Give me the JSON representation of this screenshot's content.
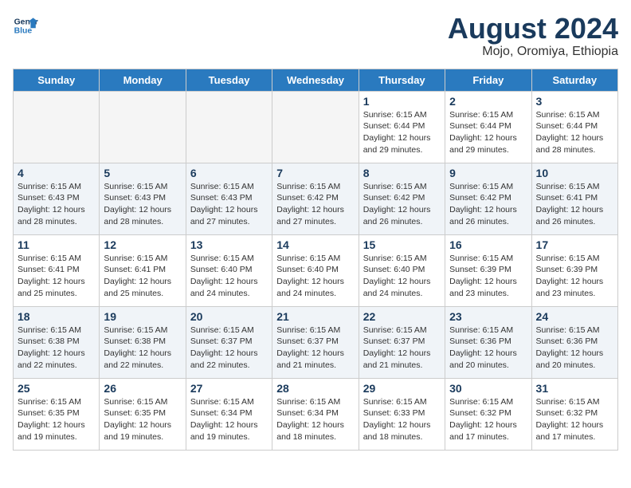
{
  "header": {
    "logo_line1": "General",
    "logo_line2": "Blue",
    "month_year": "August 2024",
    "location": "Mojo, Oromiya, Ethiopia"
  },
  "weekdays": [
    "Sunday",
    "Monday",
    "Tuesday",
    "Wednesday",
    "Thursday",
    "Friday",
    "Saturday"
  ],
  "weeks": [
    [
      {
        "day": "",
        "info": ""
      },
      {
        "day": "",
        "info": ""
      },
      {
        "day": "",
        "info": ""
      },
      {
        "day": "",
        "info": ""
      },
      {
        "day": "1",
        "info": "Sunrise: 6:15 AM\nSunset: 6:44 PM\nDaylight: 12 hours\nand 29 minutes."
      },
      {
        "day": "2",
        "info": "Sunrise: 6:15 AM\nSunset: 6:44 PM\nDaylight: 12 hours\nand 29 minutes."
      },
      {
        "day": "3",
        "info": "Sunrise: 6:15 AM\nSunset: 6:44 PM\nDaylight: 12 hours\nand 28 minutes."
      }
    ],
    [
      {
        "day": "4",
        "info": "Sunrise: 6:15 AM\nSunset: 6:43 PM\nDaylight: 12 hours\nand 28 minutes."
      },
      {
        "day": "5",
        "info": "Sunrise: 6:15 AM\nSunset: 6:43 PM\nDaylight: 12 hours\nand 28 minutes."
      },
      {
        "day": "6",
        "info": "Sunrise: 6:15 AM\nSunset: 6:43 PM\nDaylight: 12 hours\nand 27 minutes."
      },
      {
        "day": "7",
        "info": "Sunrise: 6:15 AM\nSunset: 6:42 PM\nDaylight: 12 hours\nand 27 minutes."
      },
      {
        "day": "8",
        "info": "Sunrise: 6:15 AM\nSunset: 6:42 PM\nDaylight: 12 hours\nand 26 minutes."
      },
      {
        "day": "9",
        "info": "Sunrise: 6:15 AM\nSunset: 6:42 PM\nDaylight: 12 hours\nand 26 minutes."
      },
      {
        "day": "10",
        "info": "Sunrise: 6:15 AM\nSunset: 6:41 PM\nDaylight: 12 hours\nand 26 minutes."
      }
    ],
    [
      {
        "day": "11",
        "info": "Sunrise: 6:15 AM\nSunset: 6:41 PM\nDaylight: 12 hours\nand 25 minutes."
      },
      {
        "day": "12",
        "info": "Sunrise: 6:15 AM\nSunset: 6:41 PM\nDaylight: 12 hours\nand 25 minutes."
      },
      {
        "day": "13",
        "info": "Sunrise: 6:15 AM\nSunset: 6:40 PM\nDaylight: 12 hours\nand 24 minutes."
      },
      {
        "day": "14",
        "info": "Sunrise: 6:15 AM\nSunset: 6:40 PM\nDaylight: 12 hours\nand 24 minutes."
      },
      {
        "day": "15",
        "info": "Sunrise: 6:15 AM\nSunset: 6:40 PM\nDaylight: 12 hours\nand 24 minutes."
      },
      {
        "day": "16",
        "info": "Sunrise: 6:15 AM\nSunset: 6:39 PM\nDaylight: 12 hours\nand 23 minutes."
      },
      {
        "day": "17",
        "info": "Sunrise: 6:15 AM\nSunset: 6:39 PM\nDaylight: 12 hours\nand 23 minutes."
      }
    ],
    [
      {
        "day": "18",
        "info": "Sunrise: 6:15 AM\nSunset: 6:38 PM\nDaylight: 12 hours\nand 22 minutes."
      },
      {
        "day": "19",
        "info": "Sunrise: 6:15 AM\nSunset: 6:38 PM\nDaylight: 12 hours\nand 22 minutes."
      },
      {
        "day": "20",
        "info": "Sunrise: 6:15 AM\nSunset: 6:37 PM\nDaylight: 12 hours\nand 22 minutes."
      },
      {
        "day": "21",
        "info": "Sunrise: 6:15 AM\nSunset: 6:37 PM\nDaylight: 12 hours\nand 21 minutes."
      },
      {
        "day": "22",
        "info": "Sunrise: 6:15 AM\nSunset: 6:37 PM\nDaylight: 12 hours\nand 21 minutes."
      },
      {
        "day": "23",
        "info": "Sunrise: 6:15 AM\nSunset: 6:36 PM\nDaylight: 12 hours\nand 20 minutes."
      },
      {
        "day": "24",
        "info": "Sunrise: 6:15 AM\nSunset: 6:36 PM\nDaylight: 12 hours\nand 20 minutes."
      }
    ],
    [
      {
        "day": "25",
        "info": "Sunrise: 6:15 AM\nSunset: 6:35 PM\nDaylight: 12 hours\nand 19 minutes."
      },
      {
        "day": "26",
        "info": "Sunrise: 6:15 AM\nSunset: 6:35 PM\nDaylight: 12 hours\nand 19 minutes."
      },
      {
        "day": "27",
        "info": "Sunrise: 6:15 AM\nSunset: 6:34 PM\nDaylight: 12 hours\nand 19 minutes."
      },
      {
        "day": "28",
        "info": "Sunrise: 6:15 AM\nSunset: 6:34 PM\nDaylight: 12 hours\nand 18 minutes."
      },
      {
        "day": "29",
        "info": "Sunrise: 6:15 AM\nSunset: 6:33 PM\nDaylight: 12 hours\nand 18 minutes."
      },
      {
        "day": "30",
        "info": "Sunrise: 6:15 AM\nSunset: 6:32 PM\nDaylight: 12 hours\nand 17 minutes."
      },
      {
        "day": "31",
        "info": "Sunrise: 6:15 AM\nSunset: 6:32 PM\nDaylight: 12 hours\nand 17 minutes."
      }
    ]
  ]
}
